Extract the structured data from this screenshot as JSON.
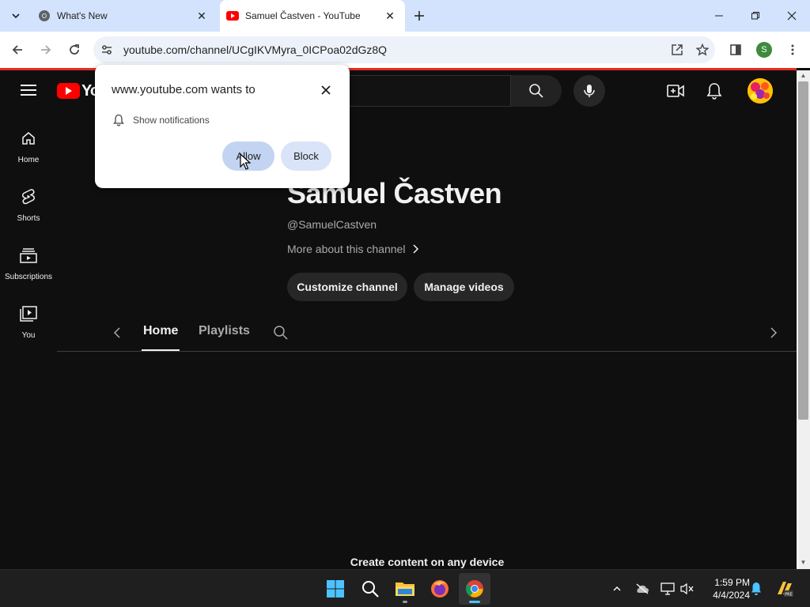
{
  "browser": {
    "tabs": [
      {
        "title": "What's New",
        "favicon": "chrome-icon",
        "active": false
      },
      {
        "title": "Samuel Častven - YouTube",
        "favicon": "youtube-icon",
        "active": true
      }
    ],
    "url": "youtube.com/channel/UCgIKVMyra_0ICPoa02dGz8Q",
    "profile_initial": "S"
  },
  "youtube": {
    "logo_text": "Yo",
    "guide": [
      {
        "label": "Home",
        "icon": "home-icon"
      },
      {
        "label": "Shorts",
        "icon": "shorts-icon"
      },
      {
        "label": "Subscriptions",
        "icon": "subscriptions-icon"
      },
      {
        "label": "You",
        "icon": "you-icon"
      }
    ],
    "channel": {
      "name": "Samuel Častven",
      "handle": "@SamuelCastven",
      "more_about": "More about this channel",
      "customize_label": "Customize channel",
      "manage_label": "Manage videos"
    },
    "channel_tabs": [
      {
        "label": "Home",
        "selected": true
      },
      {
        "label": "Playlists",
        "selected": false
      }
    ],
    "footer_text": "Create content on any device"
  },
  "permission_popup": {
    "title": "www.youtube.com wants to",
    "permission": "Show notifications",
    "allow_label": "Allow",
    "block_label": "Block"
  },
  "taskbar": {
    "apps": [
      "start-icon",
      "search-icon",
      "file-explorer-icon",
      "firefox-icon",
      "chrome-icon"
    ],
    "time": "1:59 PM",
    "date": "4/4/2024"
  },
  "colors": {
    "youtube_red": "#ff0000",
    "page_bg": "#0f0f0f",
    "tabstrip_bg": "#d3e3fd",
    "allow_bg": "#c2d4f1"
  }
}
